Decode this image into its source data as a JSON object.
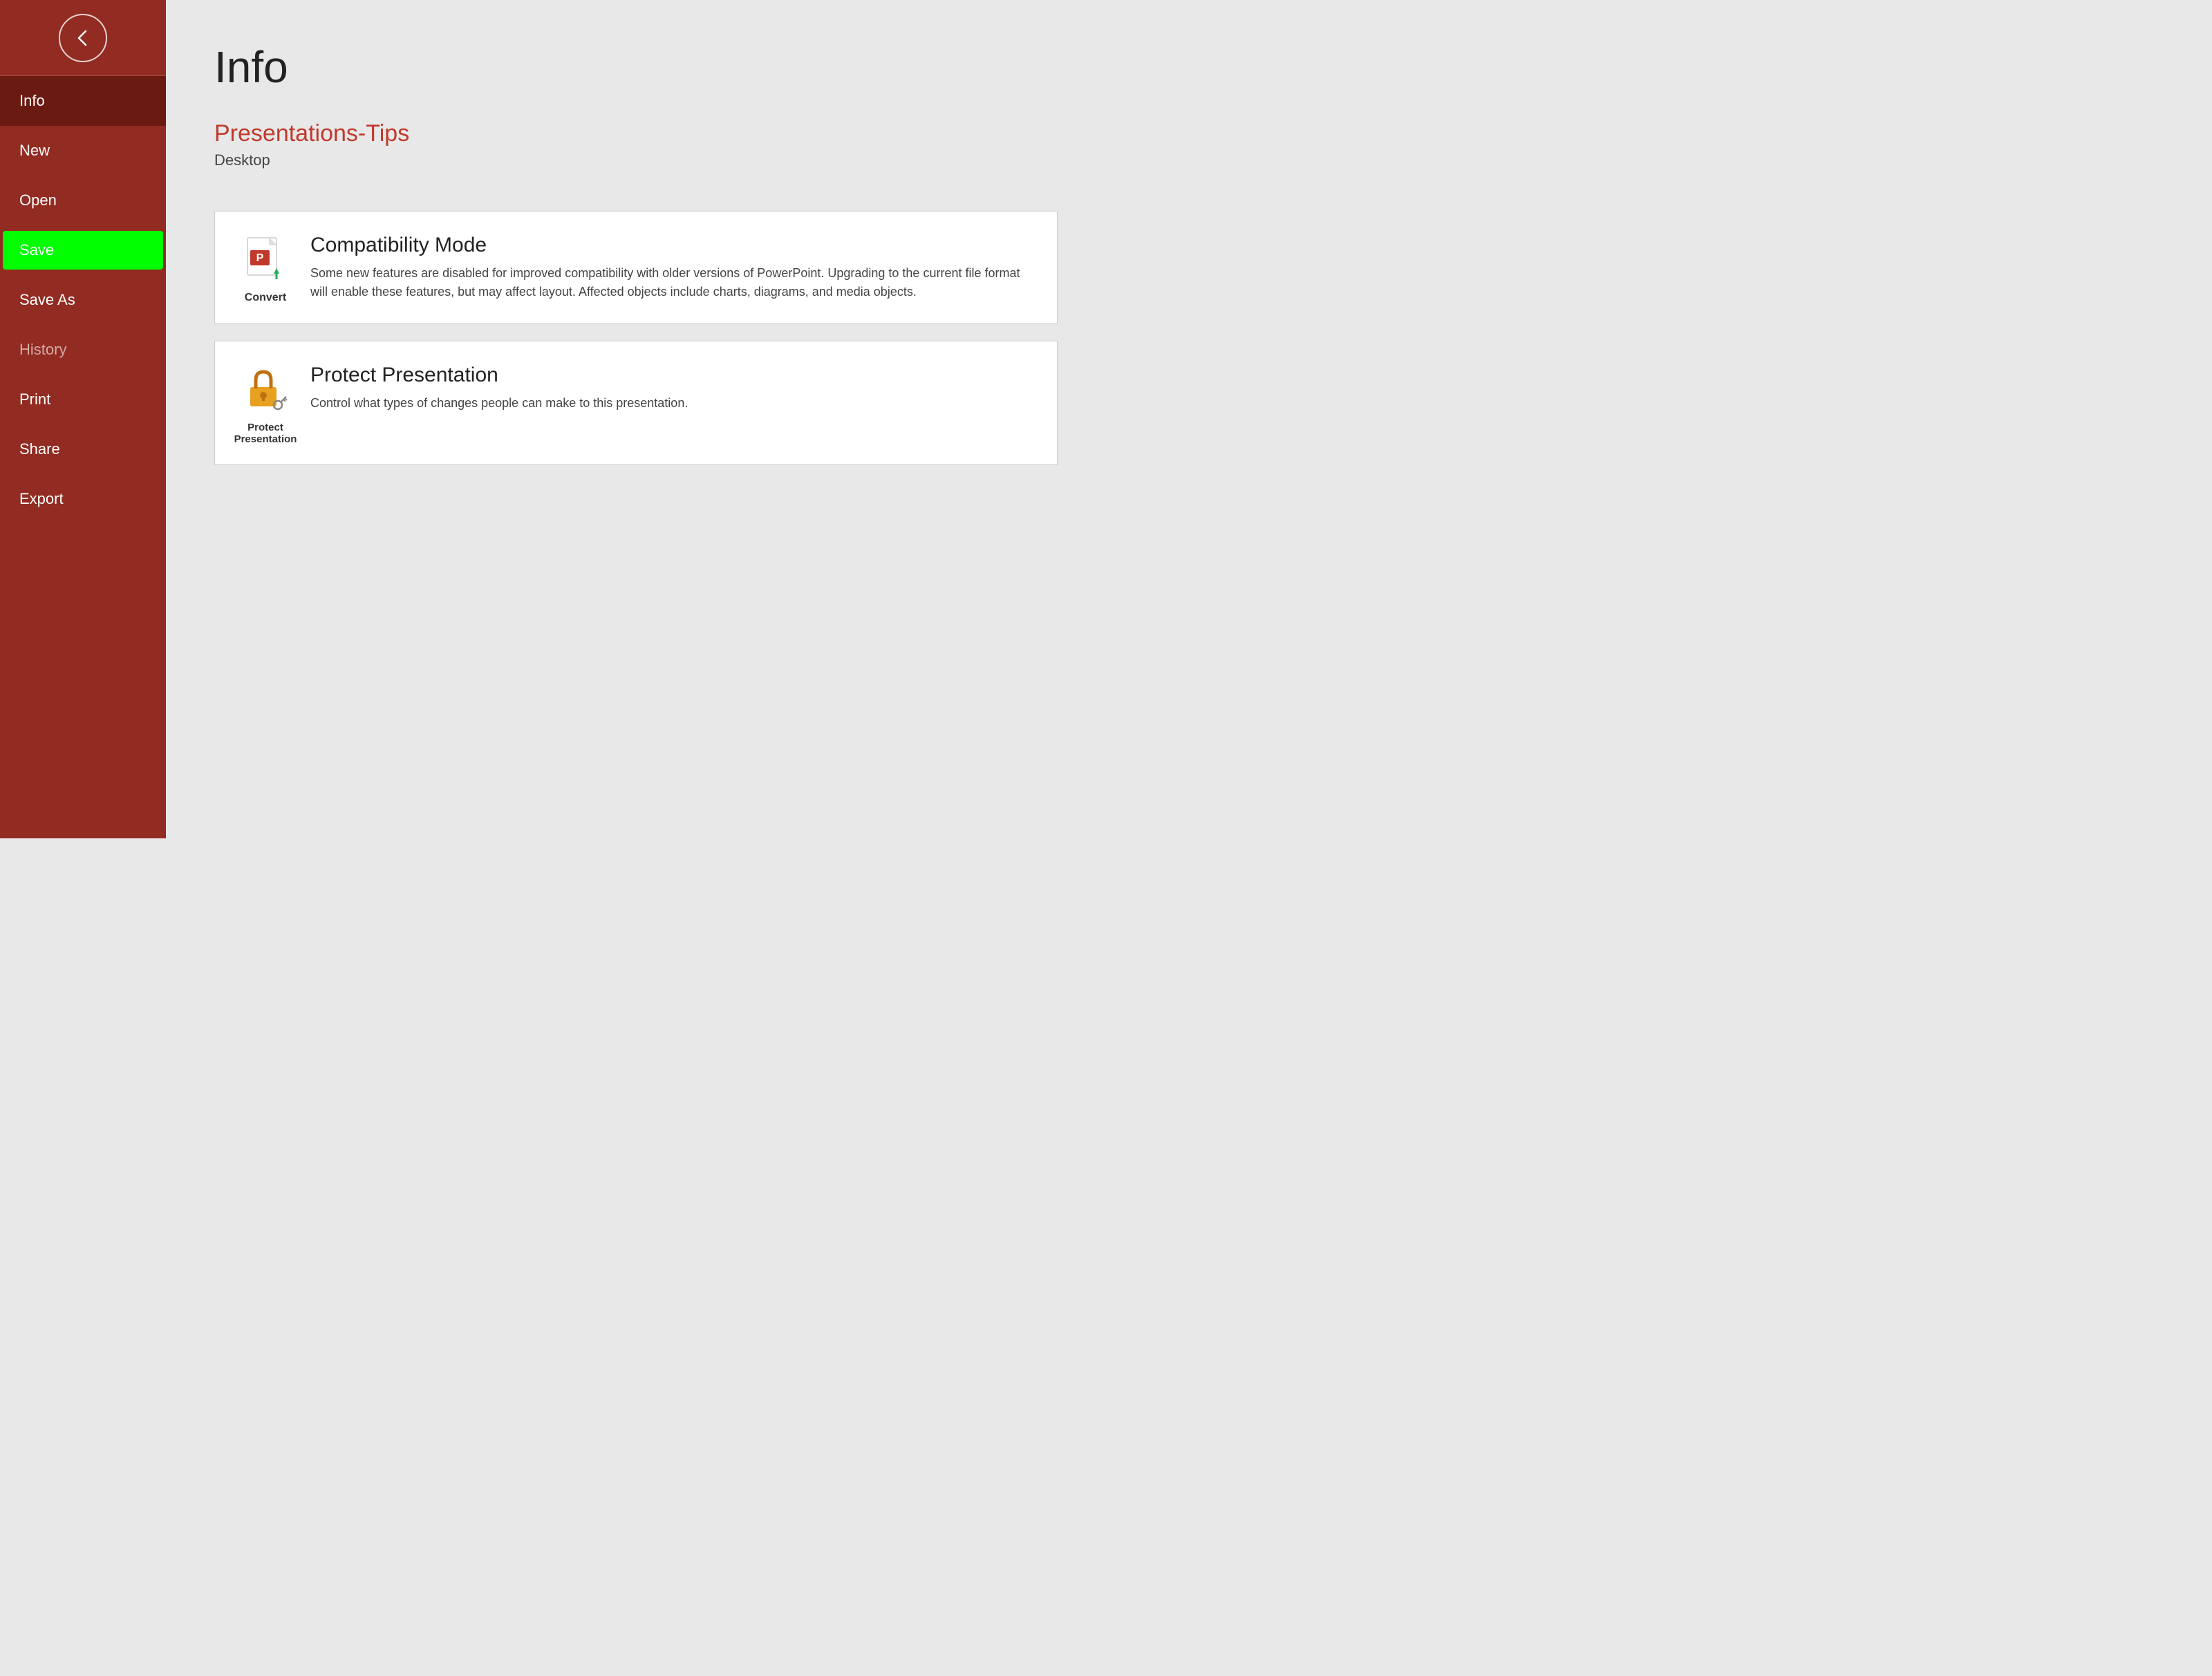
{
  "sidebar": {
    "back_button_label": "←",
    "items": [
      {
        "id": "info",
        "label": "Info",
        "state": "active"
      },
      {
        "id": "new",
        "label": "New",
        "state": "normal"
      },
      {
        "id": "open",
        "label": "Open",
        "state": "normal"
      },
      {
        "id": "save",
        "label": "Save",
        "state": "highlighted"
      },
      {
        "id": "save-as",
        "label": "Save As",
        "state": "normal"
      },
      {
        "id": "history",
        "label": "History",
        "state": "muted"
      },
      {
        "id": "print",
        "label": "Print",
        "state": "normal"
      },
      {
        "id": "share",
        "label": "Share",
        "state": "normal"
      },
      {
        "id": "export",
        "label": "Export",
        "state": "normal"
      }
    ]
  },
  "main": {
    "page_title": "Info",
    "file_title": "Presentations-Tips",
    "file_location": "Desktop",
    "cards": [
      {
        "id": "convert",
        "icon_label": "Convert",
        "title": "Compatibility Mode",
        "description": "Some new features are disabled for improved compatibility with older versions of PowerPoint. Upgrading to the current file format will enable these features, but may affect layout. Affected objects include charts, diagrams, and media objects."
      },
      {
        "id": "protect",
        "icon_label": "Protect\nPresentation",
        "title": "Protect Presentation",
        "description": "Control what types of changes people can make to this presentation."
      }
    ]
  }
}
